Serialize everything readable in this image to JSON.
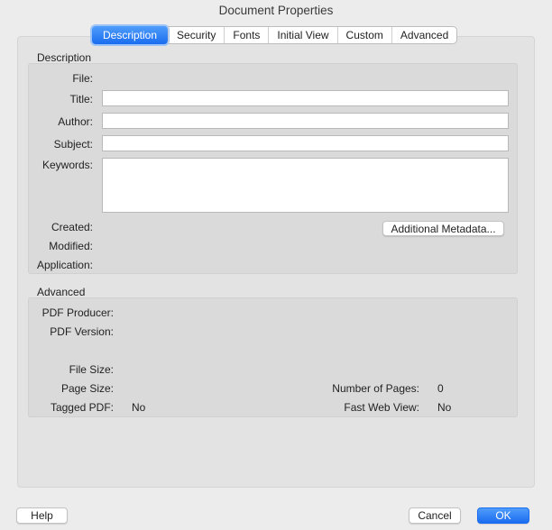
{
  "window": {
    "title": "Document Properties"
  },
  "tabs": [
    "Description",
    "Security",
    "Fonts",
    "Initial View",
    "Custom",
    "Advanced"
  ],
  "description_section": {
    "title": "Description",
    "file_label": "File:",
    "title_label": "Title:",
    "title_value": "",
    "author_label": "Author:",
    "author_value": "",
    "subject_label": "Subject:",
    "subject_value": "",
    "keywords_label": "Keywords:",
    "keywords_value": "",
    "created_label": "Created:",
    "modified_label": "Modified:",
    "application_label": "Application:",
    "metadata_button": "Additional Metadata..."
  },
  "advanced_section": {
    "title": "Advanced",
    "pdf_producer_label": "PDF Producer:",
    "pdf_version_label": "PDF Version:",
    "file_size_label": "File Size:",
    "page_size_label": "Page Size:",
    "tagged_pdf_label": "Tagged PDF:",
    "tagged_pdf_value": "No",
    "num_pages_label": "Number of Pages:",
    "num_pages_value": "0",
    "fast_web_view_label": "Fast Web View:",
    "fast_web_view_value": "No"
  },
  "footer": {
    "help": "Help",
    "cancel": "Cancel",
    "ok": "OK"
  }
}
